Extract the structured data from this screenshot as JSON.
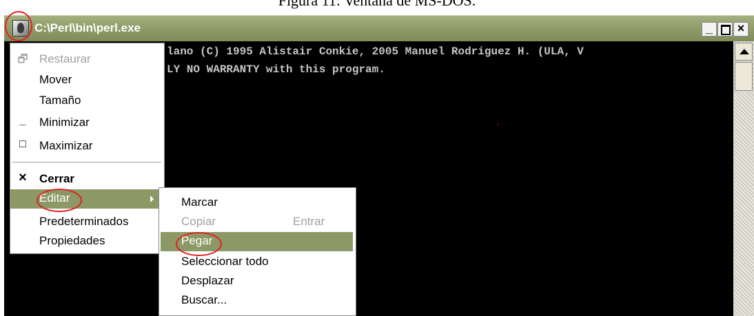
{
  "caption": "Figura 11: Ventana de MS-DOS.",
  "window": {
    "title": "C:\\Perl\\bin\\perl.exe",
    "icon": "app-icon",
    "buttons": {
      "minimize": "_",
      "maximize": "",
      "close": "×"
    }
  },
  "console": {
    "lines": [
      "lano (C) 1995 Alistair Conkie, 2005 Manuel Rodriguez H. (ULA, V",
      "LY NO WARRANTY with this program."
    ]
  },
  "system_menu": {
    "items": [
      {
        "label": "Restaurar",
        "icon": "restore-icon",
        "glyph": "ᵒ",
        "disabled": true
      },
      {
        "label": "Mover",
        "icon": "",
        "glyph": ""
      },
      {
        "label": "Tamaño",
        "icon": "",
        "glyph": ""
      },
      {
        "label": "Minimizar",
        "icon": "minimize-icon",
        "glyph": "_"
      },
      {
        "label": "Maximizar",
        "icon": "maximize-icon",
        "glyph": "□"
      },
      {
        "label": "Cerrar",
        "icon": "close-icon",
        "glyph": "×",
        "bold": true
      },
      {
        "label": "Editar",
        "highlighted": true,
        "submenu": true
      },
      {
        "label": "Predeterminados"
      },
      {
        "label": "Propiedades"
      }
    ]
  },
  "edit_menu": {
    "items": [
      {
        "label": "Marcar"
      },
      {
        "label": "Copiar",
        "shortcut": "Entrar",
        "disabled": true
      },
      {
        "label": "Pegar",
        "highlighted": true
      },
      {
        "label": "Seleccionar todo"
      },
      {
        "label": "Desplazar"
      },
      {
        "label": "Buscar..."
      }
    ]
  },
  "colors": {
    "title_bar": "#8c9966",
    "menu_highlight": "#8c9966",
    "annotation_ring": "#e02020",
    "console_bg": "#000000",
    "console_text": "#c6c6c6"
  }
}
